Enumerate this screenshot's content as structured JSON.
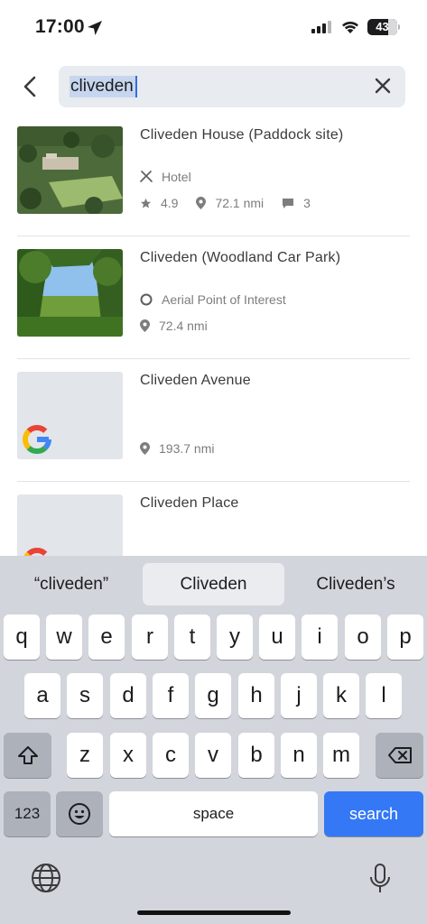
{
  "status_bar": {
    "time": "17:00",
    "battery": "43",
    "icons": [
      "location-arrow-icon",
      "cellular-signal-icon",
      "wifi-icon",
      "battery-icon"
    ]
  },
  "search": {
    "query": "cliveden",
    "back_icon": "chevron-left-icon",
    "clear_icon": "close-icon"
  },
  "results": [
    {
      "title": "Cliveden House (Paddock site)",
      "category_icon": "fork-knife-icon",
      "category": "Hotel",
      "rating": "4.9",
      "distance": "72.1 nmi",
      "comments": "3",
      "thumb": "aerial-photo"
    },
    {
      "title": "Cliveden (Woodland Car Park)",
      "category_icon": "circle-icon",
      "category": "Aerial Point of Interest",
      "distance": "72.4 nmi",
      "thumb": "woodland-photo"
    },
    {
      "title": "Cliveden Avenue",
      "distance": "193.7 nmi",
      "thumb": "google-logo"
    },
    {
      "title": "Cliveden Place",
      "thumb": "google-logo"
    }
  ],
  "keyboard": {
    "suggestions": [
      "“cliveden”",
      "Cliveden",
      "Cliveden’s"
    ],
    "row1": [
      "q",
      "w",
      "e",
      "r",
      "t",
      "y",
      "u",
      "i",
      "o",
      "p"
    ],
    "row2": [
      "a",
      "s",
      "d",
      "f",
      "g",
      "h",
      "j",
      "k",
      "l"
    ],
    "row3": [
      "z",
      "x",
      "c",
      "v",
      "b",
      "n",
      "m"
    ],
    "numbers_label": "123",
    "space_label": "space",
    "search_label": "search",
    "colors": {
      "search_key": "#3478f6",
      "background": "#d2d5db"
    }
  }
}
